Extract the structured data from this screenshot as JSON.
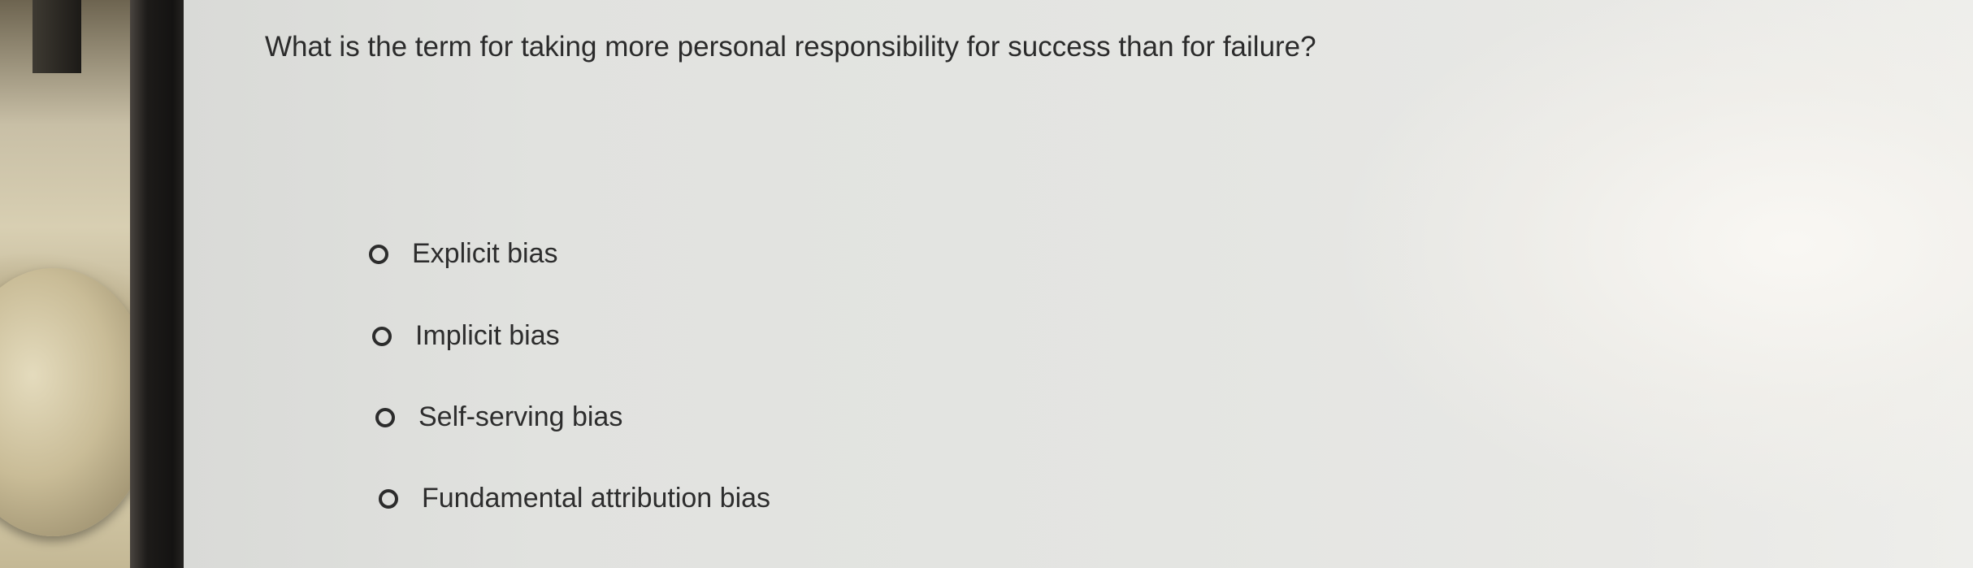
{
  "quiz": {
    "question": "What is the term for taking more personal responsibility for success than for failure?",
    "options": [
      {
        "label": "Explicit bias",
        "selected": false
      },
      {
        "label": "Implicit bias",
        "selected": false
      },
      {
        "label": "Self-serving bias",
        "selected": false
      },
      {
        "label": "Fundamental attribution bias",
        "selected": false
      }
    ]
  },
  "icons": {
    "option_radio": "radio-unselected-icon"
  }
}
